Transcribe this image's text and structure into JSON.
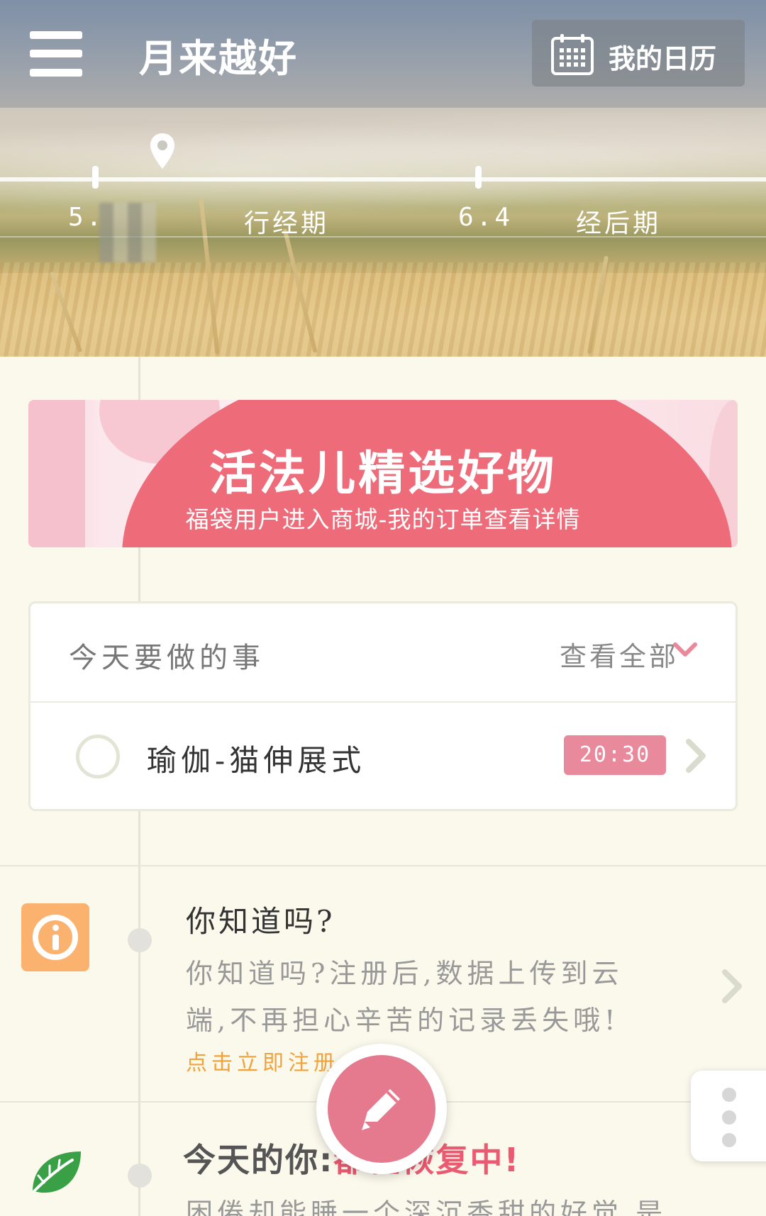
{
  "header": {
    "app_title": "月来越好",
    "calendar_label": "我的日历"
  },
  "cycle": {
    "start_date": "5.",
    "phase1": "行经期",
    "mid_date": "6.4",
    "phase2": "经后期"
  },
  "banner": {
    "title": "活法儿精选好物",
    "subtitle": "福袋用户进入商城-我的订单查看详情",
    "colors": {
      "accent": "#ee6c7a",
      "background": "#fbe7ec"
    }
  },
  "todo": {
    "title": "今天要做的事",
    "view_all": "查看全部",
    "items": [
      {
        "label": "瑜伽-猫伸展式",
        "time": "20:30",
        "done": false
      }
    ]
  },
  "tip": {
    "icon": "info-icon",
    "title": "你知道吗?",
    "body_line1": "你知道吗?注册后,数据上传到云",
    "body_line2": "端,不再担心辛苦的记录丢失哦!",
    "link": "点击立即注册"
  },
  "today": {
    "icon": "leaf-icon",
    "title_prefix": "今天的你:",
    "title_highlight": "都在恢复中!",
    "body": "困倦却能睡一个深沉香甜的好觉,是"
  },
  "fab": {
    "icon": "pencil-icon"
  },
  "more": {
    "icon": "more-vertical-icon"
  },
  "colors": {
    "pink": "#e5798d",
    "orange": "#fcb26f",
    "link_orange": "#f2a23c",
    "page_bg": "#fbf9ec"
  }
}
